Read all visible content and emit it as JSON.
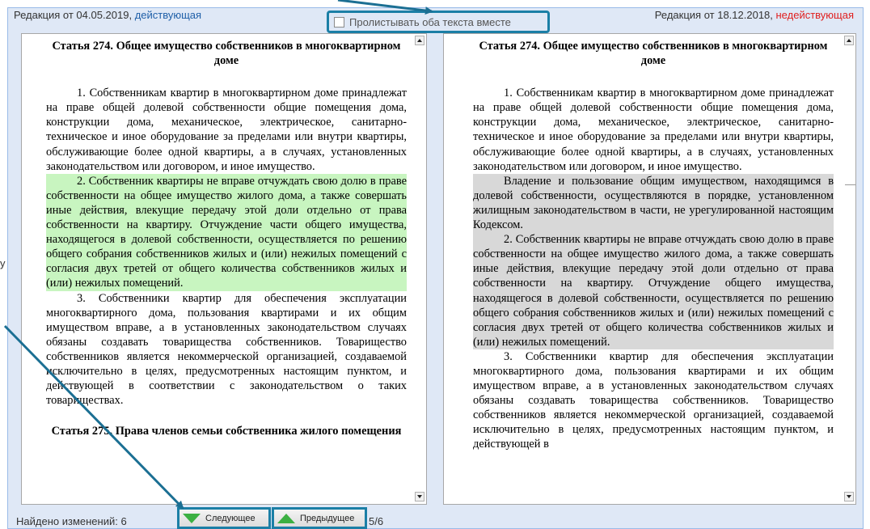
{
  "header": {
    "left_prefix": "Редакция от 04.05.2019, ",
    "left_status": "действующая",
    "right_prefix": "Редакция от 18.12.2018, ",
    "right_status": "недействующая",
    "sync_label": "Пролистывать оба текста вместе"
  },
  "left": {
    "title": "Статья 274. Общее имущество собственников в многоквартирном доме",
    "p1": "1. Собственникам квартир в многоквартирном доме принадлежат на праве общей долевой собственности общие помещения дома, конструкции дома, механическое, электрическое, санитарно-техническое и иное оборудование за пределами или внутри квартиры, обслуживающие более одной квартиры, а в случаях, установленных законодательством или договором, и иное имущество.",
    "p2": "2. Собственник квартиры не вправе отчуждать свою долю в праве собственности на общее имущество жилого дома, а также совершать иные действия, влекущие передачу этой доли отдельно от права собственности на квартиру. Отчуждение части общего имущества, находящегося в долевой собственности, осуществляется по решению общего собрания собственников жилых и (или) нежилых помещений с согласия двух третей от общего количества собственников жилых и (или) нежилых помещений.",
    "p3": "3. Собственники квартир для обеспечения эксплуатации многоквартирного дома, пользования квартирами и их общим имуществом вправе, а в установленных законодательством случаях обязаны создавать товарищества собственников. Товарищество собственников является некоммерческой организацией, создаваемой исключительно в целях, предусмотренных настоящим пунктом, и действующей в соответствии с законодательством о таких товариществах.",
    "title2": "Статья 275. Права членов семьи собственника жилого помещения"
  },
  "right": {
    "title": "Статья 274. Общее имущество собственников в многоквартирном доме",
    "p1": "1. Собственникам квартир в многоквартирном доме принадлежат на праве общей долевой собственности общие помещения дома, конструкции дома, механическое, электрическое, санитарно-техническое и иное оборудование за пределами или внутри квартиры, обслуживающие более одной квартиры, а в случаях, установленных законодательством или договором, и иное имущество.",
    "p_removed": "Владение и пользование общим имуществом, находящимся в долевой собственности, осуществляются в порядке, установленном жилищным законодательством в части, не урегулированной настоящим Кодексом.",
    "p2": "2. Собственник квартиры не вправе отчуждать свою долю в праве собственности на общее имущество жилого дома, а также совершать иные действия, влекущие передачу этой доли отдельно от права собственности на квартиру. Отчуждение общего имущества, находящегося в долевой собственности, осуществляется по решению общего собрания собственников жилых и (или) нежилых помещений с согласия двух третей от общего количества собственников жилых и (или) нежилых помещений.",
    "p3": "3. Собственники квартир для обеспечения эксплуатации многоквартирного дома, пользования квартирами и их общим имуществом вправе, а в установленных законодательством случаях обязаны создавать товарищества собственников. Товарищество собственников является некоммерческой организацией, создаваемой исключительно в целях, предусмотренных настоящим пунктом, и действующей в"
  },
  "footer": {
    "changes_found": "Найдено изменений: 6",
    "next_label": "Следующее",
    "prev_label": "Предыдущее",
    "pager": "5/6"
  },
  "edge_letter": "у",
  "colors": {
    "accent": "#1b7fa6",
    "added_highlight": "#c8f5c0",
    "removed_highlight": "#d8d8d8",
    "status_active": "#1f5fa8",
    "status_inactive": "#e02020"
  },
  "icons": {
    "next": "green-arrow-down-icon",
    "prev": "green-arrow-up-icon",
    "scroll_up": "scroll-up-icon",
    "scroll_down": "scroll-down-icon"
  }
}
